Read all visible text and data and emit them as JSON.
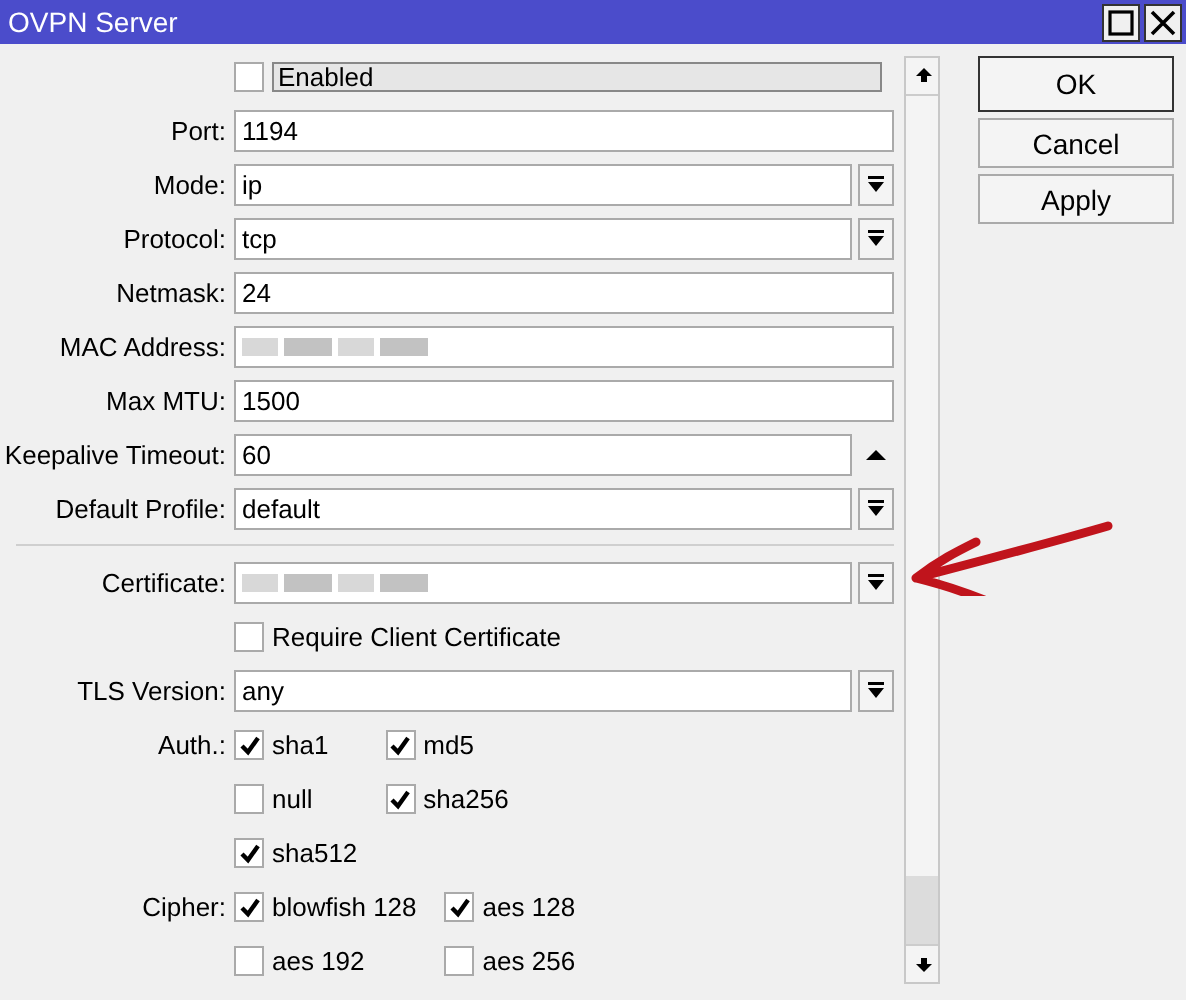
{
  "window": {
    "title": "OVPN Server"
  },
  "fields": [
    {
      "kind": "banner-checkbox",
      "label": "Enabled",
      "checked": false
    },
    {
      "kind": "text",
      "label": "Port:",
      "value": "1194"
    },
    {
      "kind": "select",
      "label": "Mode:",
      "value": "ip"
    },
    {
      "kind": "select",
      "label": "Protocol:",
      "value": "tcp"
    },
    {
      "kind": "text",
      "label": "Netmask:",
      "value": "24"
    },
    {
      "kind": "text",
      "label": "MAC Address:",
      "redacted": true
    },
    {
      "kind": "text",
      "label": "Max MTU:",
      "value": "1500"
    },
    {
      "kind": "spinner",
      "label": "Keepalive Timeout:",
      "value": "60"
    },
    {
      "kind": "select",
      "label": "Default Profile:",
      "value": "default"
    },
    {
      "kind": "separator"
    },
    {
      "kind": "select",
      "label": "Certificate:",
      "redacted": true
    },
    {
      "kind": "checkbox",
      "label": "Require Client Certificate",
      "checked": false
    },
    {
      "kind": "select",
      "label": "TLS Version:",
      "value": "any"
    },
    {
      "kind": "checkgroup",
      "label": "Auth.:",
      "options": [
        {
          "label": "sha1",
          "checked": true
        },
        {
          "label": "md5",
          "checked": true
        },
        {
          "label": "null",
          "checked": false
        },
        {
          "label": "sha256",
          "checked": true
        },
        {
          "label": "sha512",
          "checked": true
        }
      ]
    },
    {
      "kind": "checkgroup",
      "label": "Cipher:",
      "options": [
        {
          "label": "blowfish 128",
          "checked": true
        },
        {
          "label": "aes 128",
          "checked": true
        },
        {
          "label": "aes 192",
          "checked": false
        },
        {
          "label": "aes 256",
          "checked": false
        }
      ]
    }
  ],
  "buttons": [
    {
      "label": "OK",
      "default": true
    },
    {
      "label": "Cancel",
      "default": false
    },
    {
      "label": "Apply",
      "default": false
    }
  ]
}
